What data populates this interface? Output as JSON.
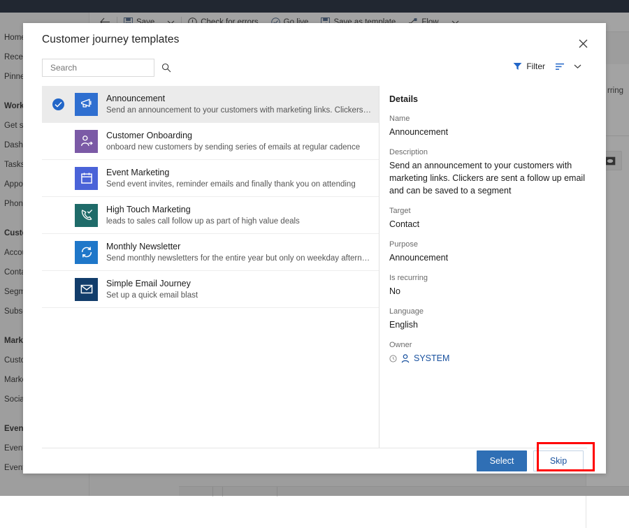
{
  "background": {
    "nav_items": [
      {
        "label": "Home",
        "bold": false,
        "gap_before": false
      },
      {
        "label": "Recent",
        "bold": false,
        "gap_before": false
      },
      {
        "label": "Pinned",
        "bold": false,
        "gap_before": false
      },
      {
        "label": "Work",
        "bold": true,
        "gap_before": true
      },
      {
        "label": "Get started",
        "bold": false,
        "gap_before": false
      },
      {
        "label": "Dashboards",
        "bold": false,
        "gap_before": false
      },
      {
        "label": "Tasks",
        "bold": false,
        "gap_before": false
      },
      {
        "label": "Appointments",
        "bold": false,
        "gap_before": false
      },
      {
        "label": "Phone Calls",
        "bold": false,
        "gap_before": false
      },
      {
        "label": "Customers",
        "bold": true,
        "gap_before": true
      },
      {
        "label": "Accounts",
        "bold": false,
        "gap_before": false
      },
      {
        "label": "Contacts",
        "bold": false,
        "gap_before": false
      },
      {
        "label": "Segments",
        "bold": false,
        "gap_before": false
      },
      {
        "label": "Subscription",
        "bold": false,
        "gap_before": false
      },
      {
        "label": "Marketing execution",
        "bold": true,
        "gap_before": true
      },
      {
        "label": "Customer journeys",
        "bold": false,
        "gap_before": false
      },
      {
        "label": "Marketing emails",
        "bold": false,
        "gap_before": false
      },
      {
        "label": "Social posts",
        "bold": false,
        "gap_before": false
      },
      {
        "label": "Event management",
        "bold": true,
        "gap_before": true
      },
      {
        "label": "Events",
        "bold": false,
        "gap_before": false
      },
      {
        "label": "Event Registrations",
        "bold": false,
        "gap_before": false
      }
    ],
    "commands": [
      {
        "label": "Save",
        "icon": "save-icon"
      },
      {
        "label": "Check for errors",
        "icon": "error-circle-icon"
      },
      {
        "label": "Go live",
        "icon": "check-circle-icon"
      },
      {
        "label": "Save as template",
        "icon": "save-template-icon"
      },
      {
        "label": "Flow",
        "icon": "flow-icon"
      }
    ],
    "back_icon": "back-arrow-icon",
    "right_panel_text": "rring"
  },
  "dialog": {
    "title": "Customer journey templates",
    "close_icon": "close-icon",
    "search": {
      "placeholder": "Search",
      "value": "",
      "icon": "search-icon"
    },
    "filter": {
      "label": "Filter",
      "icon": "filter-icon",
      "sort_icon": "sort-icon",
      "chevron_icon": "chevron-down-icon",
      "accent": "#2266c8"
    },
    "templates": [
      {
        "name": "Announcement",
        "description": "Send an announcement to your customers with marketing links. Clickers are sent a...",
        "icon": "megaphone-icon",
        "tile_color": "#2f6fd0",
        "selected": true
      },
      {
        "name": "Customer Onboarding",
        "description": "onboard new customers by sending series of emails at regular cadence",
        "icon": "person-arrow-icon",
        "tile_color": "#7b5aa6",
        "selected": false
      },
      {
        "name": "Event Marketing",
        "description": "Send event invites, reminder emails and finally thank you on attending",
        "icon": "calendar-icon",
        "tile_color": "#4a63d8",
        "selected": false
      },
      {
        "name": "High Touch Marketing",
        "description": "leads to sales call follow up as part of high value deals",
        "icon": "phone-check-icon",
        "tile_color": "#1f6b69",
        "selected": false
      },
      {
        "name": "Monthly Newsletter",
        "description": "Send monthly newsletters for the entire year but only on weekday afternoons",
        "icon": "refresh-cycle-icon",
        "tile_color": "#1f77c9",
        "selected": false
      },
      {
        "name": "Simple Email Journey",
        "description": "Set up a quick email blast",
        "icon": "envelope-icon",
        "tile_color": "#123d6b",
        "selected": false
      }
    ],
    "details": {
      "heading": "Details",
      "fields": [
        {
          "label": "Name",
          "value": "Announcement"
        },
        {
          "label": "Description",
          "value": "Send an announcement to your customers with marketing links. Clickers are sent a follow up email and can be saved to a segment"
        },
        {
          "label": "Target",
          "value": "Contact"
        },
        {
          "label": "Purpose",
          "value": "Announcement"
        },
        {
          "label": "Is recurring",
          "value": "No"
        },
        {
          "label": "Language",
          "value": "English"
        }
      ],
      "owner": {
        "label": "Owner",
        "name": "SYSTEM",
        "status_icon": "presence-icon",
        "person_icon": "person-icon",
        "link_color": "#17509e"
      }
    },
    "footer": {
      "select_label": "Select",
      "skip_label": "Skip",
      "primary_color": "#2f6fb5",
      "highlight_color": "#ff0000"
    }
  }
}
